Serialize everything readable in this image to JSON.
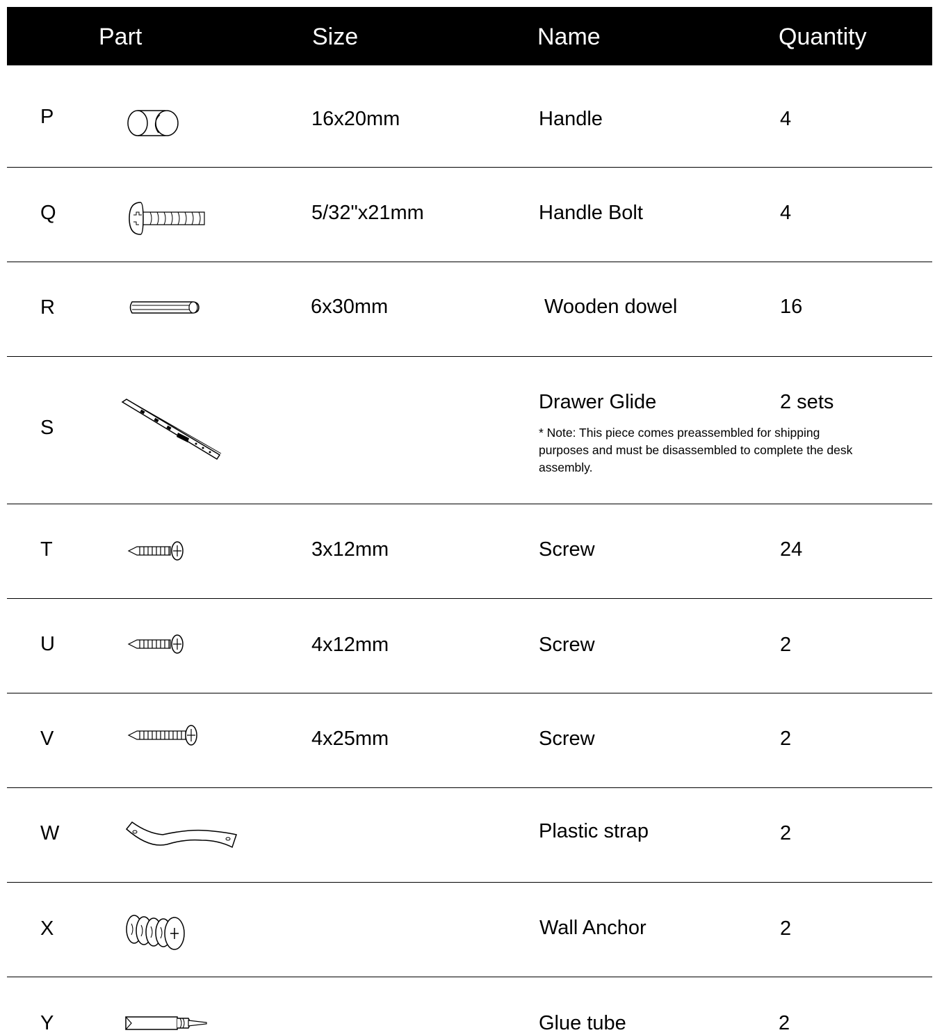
{
  "header": {
    "part": "Part",
    "size": "Size",
    "name": "Name",
    "quantity": "Quantity"
  },
  "rows": [
    {
      "letter": "P",
      "icon": "handle-icon",
      "size": "16x20mm",
      "name": "Handle",
      "quantity": "4"
    },
    {
      "letter": "Q",
      "icon": "handle-bolt-icon",
      "size": "5/32\"x21mm",
      "name": "Handle Bolt",
      "quantity": "4"
    },
    {
      "letter": "R",
      "icon": "wooden-dowel-icon",
      "size": "6x30mm",
      "name": "Wooden dowel",
      "quantity": "16"
    },
    {
      "letter": "S",
      "icon": "drawer-glide-icon",
      "size": "",
      "name": "Drawer Glide",
      "quantity": "2 sets",
      "note": "* Note: This piece comes preassembled for shipping purposes and must be disassembled to complete the desk assembly."
    },
    {
      "letter": "T",
      "icon": "screw-icon",
      "size": "3x12mm",
      "name": "Screw",
      "quantity": "24"
    },
    {
      "letter": "U",
      "icon": "screw-icon",
      "size": "4x12mm",
      "name": "Screw",
      "quantity": "2"
    },
    {
      "letter": "V",
      "icon": "long-screw-icon",
      "size": "4x25mm",
      "name": "Screw",
      "quantity": "2"
    },
    {
      "letter": "W",
      "icon": "plastic-strap-icon",
      "size": "",
      "name": "Plastic strap",
      "quantity": "2"
    },
    {
      "letter": "X",
      "icon": "wall-anchor-icon",
      "size": "",
      "name": "Wall Anchor",
      "quantity": "2"
    },
    {
      "letter": "Y",
      "icon": "glue-tube-icon",
      "size": "",
      "name": "Glue tube",
      "quantity": "2"
    }
  ]
}
